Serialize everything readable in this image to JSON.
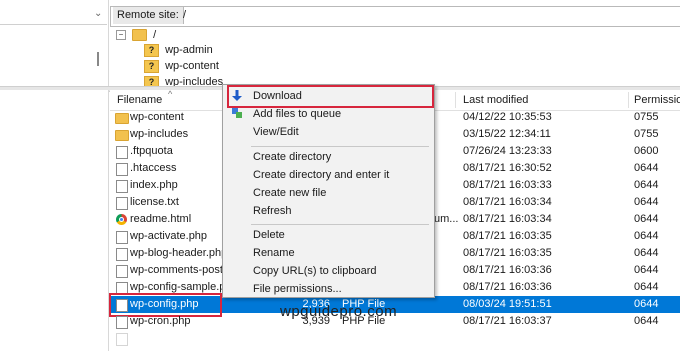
{
  "remote": {
    "label": "Remote site:",
    "path": "/"
  },
  "tree": {
    "root": "/",
    "items": [
      "wp-admin",
      "wp-content",
      "wp-includes"
    ]
  },
  "columns": {
    "filename": "Filename",
    "last_modified": "Last modified",
    "permissions": "Permissio"
  },
  "files": [
    {
      "name": "wp-content",
      "icon": "folder",
      "size": "",
      "type": "",
      "modified": "04/12/22 10:35:53",
      "perm": "0755"
    },
    {
      "name": "wp-includes",
      "icon": "folder",
      "size": "",
      "type": "",
      "modified": "03/15/22 12:34:11",
      "perm": "0755"
    },
    {
      "name": ".ftpquota",
      "icon": "file",
      "size": "",
      "type": "",
      "modified": "07/26/24 13:23:33",
      "perm": "0600"
    },
    {
      "name": ".htaccess",
      "icon": "file",
      "size": "",
      "type": "",
      "modified": "08/17/21 16:30:52",
      "perm": "0644"
    },
    {
      "name": "index.php",
      "icon": "file",
      "size": "",
      "type": "",
      "modified": "08/17/21 16:03:33",
      "perm": "0644"
    },
    {
      "name": "license.txt",
      "icon": "file",
      "size": "",
      "type": "",
      "modified": "08/17/21 16:03:34",
      "perm": "0644"
    },
    {
      "name": "readme.html",
      "icon": "chrome",
      "size": "",
      "type": "um...",
      "modified": "08/17/21 16:03:34",
      "perm": "0644"
    },
    {
      "name": "wp-activate.php",
      "icon": "file",
      "size": "",
      "type": "",
      "modified": "08/17/21 16:03:35",
      "perm": "0644"
    },
    {
      "name": "wp-blog-header.php",
      "icon": "file",
      "size": "",
      "type": "",
      "modified": "08/17/21 16:03:35",
      "perm": "0644"
    },
    {
      "name": "wp-comments-post.",
      "icon": "file",
      "size": "",
      "type": "",
      "modified": "08/17/21 16:03:36",
      "perm": "0644"
    },
    {
      "name": "wp-config-sample.p",
      "icon": "file",
      "size": "",
      "type": "",
      "modified": "08/17/21 16:03:36",
      "perm": "0644"
    },
    {
      "name": "wp-config.php",
      "icon": "file",
      "size": "2,936",
      "type": "PHP File",
      "modified": "08/03/24 19:51:51",
      "perm": "0644"
    },
    {
      "name": "wp-cron.php",
      "icon": "file",
      "size": "3,939",
      "type": "PHP File",
      "modified": "08/17/21 16:03:37",
      "perm": "0644"
    }
  ],
  "menu": {
    "group1": [
      "Download",
      "Add files to queue",
      "View/Edit"
    ],
    "group2": [
      "Create directory",
      "Create directory and enter it",
      "Create new file",
      "Refresh"
    ],
    "group3": [
      "Delete",
      "Rename",
      "Copy URL(s) to clipboard",
      "File permissions..."
    ]
  },
  "watermark": "wpguidepro.com",
  "colors": {
    "selection": "#0078d7",
    "highlight_box": "#d7263d",
    "download_arrow": "#1e5cc8"
  }
}
